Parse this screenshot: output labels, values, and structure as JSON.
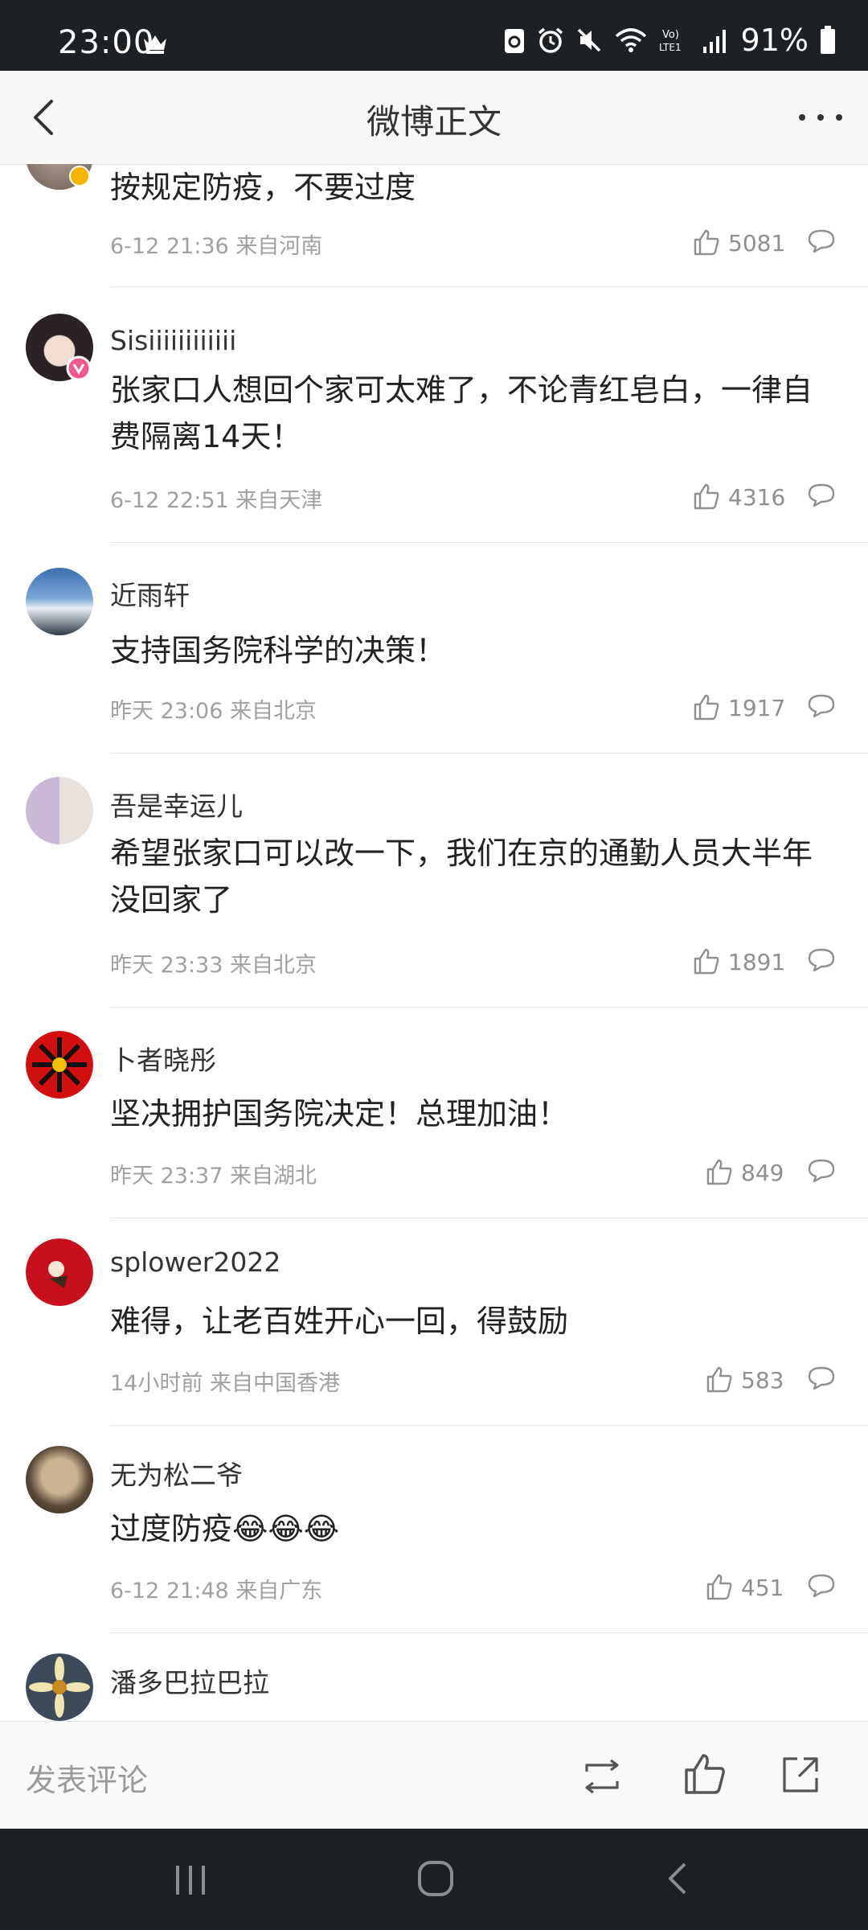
{
  "status_bar": {
    "time": "23:00",
    "battery": "91%"
  },
  "header": {
    "title": "微博正文"
  },
  "comments": [
    {
      "username": "",
      "content": "按规定防疫，不要过度",
      "time": "6-12 21:36",
      "location": "来自河南",
      "likes": "5081"
    },
    {
      "username": "Sisiiiiiiiiiiii",
      "content": "张家口人想回个家可太难了，不论青红皂白，一律自费隔离14天！",
      "time": "6-12 22:51",
      "location": "来自天津",
      "likes": "4316"
    },
    {
      "username": "近雨轩",
      "content": "支持国务院科学的决策！",
      "time": "昨天 23:06",
      "location": "来自北京",
      "likes": "1917"
    },
    {
      "username": "吾是幸运儿",
      "content": "希望张家口可以改一下，我们在京的通勤人员大半年没回家了",
      "time": "昨天 23:33",
      "location": "来自北京",
      "likes": "1891"
    },
    {
      "username": "卜者晓彤",
      "content": "坚决拥护国务院决定！总理加油！",
      "time": "昨天 23:37",
      "location": "来自湖北",
      "likes": "849"
    },
    {
      "username": "splower2022",
      "content": "难得，让老百姓开心一回，得鼓励",
      "time": "14小时前",
      "location": "来自中国香港",
      "likes": "583"
    },
    {
      "username": "无为松二爷",
      "content": "过度防疫😂😂😂",
      "time": "6-12 21:48",
      "location": "来自广东",
      "likes": "451"
    },
    {
      "username": "潘多巴拉巴拉",
      "content": "",
      "time": "",
      "location": "",
      "likes": ""
    }
  ],
  "bottom_bar": {
    "comment_placeholder": "发表评论"
  },
  "colors": {
    "status_bar_bg": "#1d2025",
    "header_bg": "#f7f7f7",
    "meta_text": "#a0a0a0",
    "vip_badge": "#f0598b",
    "gold_badge": "#f5b400"
  },
  "icons": [
    "back-arrow-icon",
    "more-dots-icon",
    "thumbs-up-icon",
    "comment-bubble-icon",
    "repost-icon",
    "share-icon",
    "wifi-icon",
    "signal-icon",
    "battery-icon",
    "alarm-icon",
    "mute-icon",
    "crown-icon"
  ]
}
